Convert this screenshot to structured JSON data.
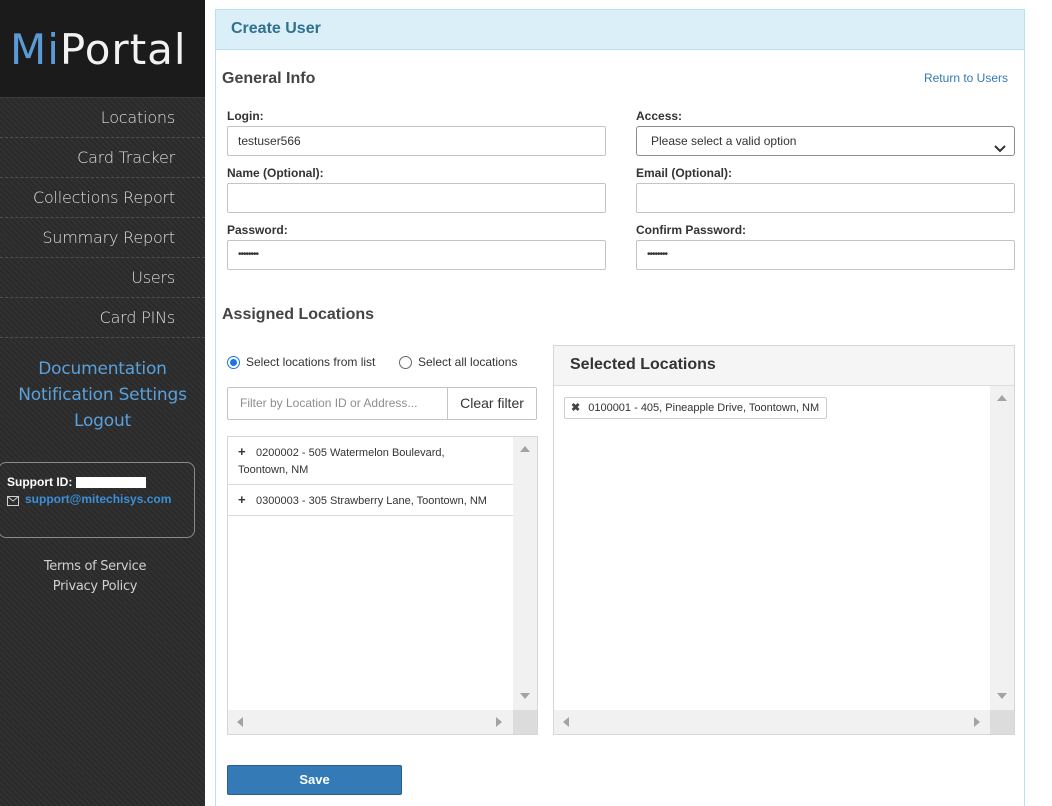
{
  "sidebar": {
    "logo": {
      "mi": "Mi",
      "portal": "Portal"
    },
    "nav": [
      {
        "label": "Locations"
      },
      {
        "label": "Card Tracker"
      },
      {
        "label": "Collections Report"
      },
      {
        "label": "Summary Report"
      },
      {
        "label": "Users"
      },
      {
        "label": "Card PINs"
      }
    ],
    "links": [
      {
        "label": "Documentation"
      },
      {
        "label": "Notification Settings"
      },
      {
        "label": "Logout"
      }
    ],
    "support": {
      "id_label": "Support ID:",
      "email": "support@mitechisys.com",
      "mail_icon": "envelope-icon"
    },
    "legal": [
      {
        "label": "Terms of Service"
      },
      {
        "label": "Privacy Policy"
      }
    ]
  },
  "panel": {
    "title": "Create User",
    "general_info_title": "General Info",
    "return_link": "Return to Users",
    "fields": {
      "login": {
        "label": "Login:",
        "value": "testuser566"
      },
      "access": {
        "label": "Access:",
        "value": "Please select a valid option"
      },
      "name": {
        "label": "Name (Optional):",
        "value": ""
      },
      "email": {
        "label": "Email (Optional):",
        "value": ""
      },
      "password": {
        "label": "Password:",
        "value": "••••••••"
      },
      "confirm_password": {
        "label": "Confirm Password:",
        "value": "••••••••"
      }
    },
    "assigned_title": "Assigned Locations",
    "radio": {
      "from_list": "Select locations from list",
      "all": "Select all locations",
      "selected": "from_list"
    },
    "filter": {
      "placeholder": "Filter by Location ID or Address...",
      "clear_label": "Clear filter"
    },
    "available": [
      {
        "text": "0200002 - 505 Watermelon Boulevard, Toontown, NM"
      },
      {
        "text": "0300003 - 305 Strawberry Lane, Toontown, NM"
      }
    ],
    "selected_title": "Selected Locations",
    "selected": [
      {
        "text": "0100001 - 405, Pineapple Drive, Toontown, NM"
      }
    ],
    "save_label": "Save"
  },
  "colors": {
    "accent": "#337ab7",
    "logo_mi": "#5b9bd5",
    "sidebar_link": "#5aa0db",
    "panel_header_bg": "#daeff8",
    "panel_title": "#31708f"
  }
}
